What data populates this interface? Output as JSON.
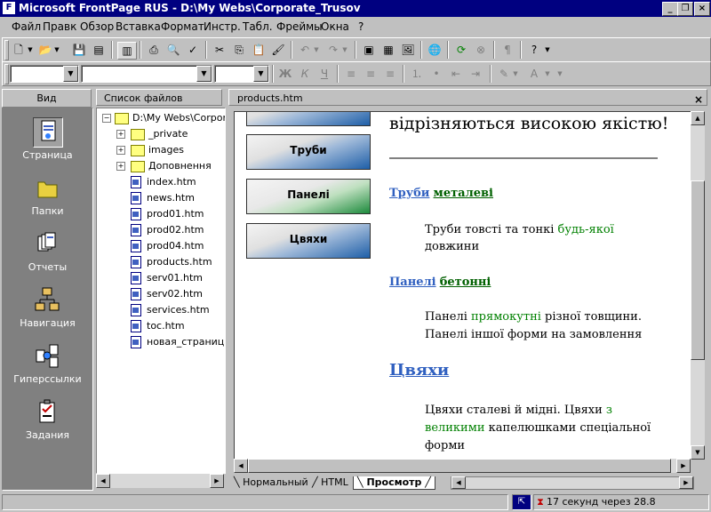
{
  "window": {
    "title": "Microsoft FrontPage RUS - D:\\My Webs\\Corporate_Trusov"
  },
  "menu": [
    "Файл",
    "Правк",
    "Обзор",
    "Вставка",
    "Формат",
    "Инстр.",
    "Табл.",
    "Фреймы",
    "Окна",
    "?"
  ],
  "views": {
    "header": "Вид",
    "items": [
      {
        "label": "Страница",
        "icon": "page-view-icon",
        "selected": true
      },
      {
        "label": "Папки",
        "icon": "folders-view-icon"
      },
      {
        "label": "Отчеты",
        "icon": "reports-view-icon"
      },
      {
        "label": "Навигация",
        "icon": "navigation-view-icon"
      },
      {
        "label": "Гиперссылки",
        "icon": "hyperlinks-view-icon"
      },
      {
        "label": "Задания",
        "icon": "tasks-view-icon"
      }
    ]
  },
  "folder_list": {
    "header": "Список файлов",
    "root": "D:\\My Webs\\Corpora",
    "items": [
      {
        "name": "_private",
        "type": "folder"
      },
      {
        "name": "images",
        "type": "folder"
      },
      {
        "name": "Доповнення",
        "type": "folder"
      },
      {
        "name": "index.htm",
        "type": "page"
      },
      {
        "name": "news.htm",
        "type": "page"
      },
      {
        "name": "prod01.htm",
        "type": "page"
      },
      {
        "name": "prod02.htm",
        "type": "page"
      },
      {
        "name": "prod04.htm",
        "type": "page"
      },
      {
        "name": "products.htm",
        "type": "page"
      },
      {
        "name": "serv01.htm",
        "type": "page"
      },
      {
        "name": "serv02.htm",
        "type": "page"
      },
      {
        "name": "services.htm",
        "type": "page"
      },
      {
        "name": "toc.htm",
        "type": "page"
      },
      {
        "name": "новая_страница",
        "type": "page"
      }
    ]
  },
  "document": {
    "tab_title": "products.htm",
    "close": "×",
    "nav_buttons": [
      "Труби",
      "Панелі",
      "Цвяхи"
    ],
    "heading_partial": "відрізняються високою якістю!",
    "sections": [
      {
        "link": "Труби",
        "rest": "металеві",
        "lines": [
          [
            "Труби товсті та тонкі ",
            "будь-якої"
          ],
          [
            "довжини",
            ""
          ]
        ]
      },
      {
        "link": "Панелі",
        "rest": "бетонні",
        "lines": [
          [
            "Панелі ",
            "прямокутні",
            " різної товщини."
          ],
          [
            "Панелі іншої форми на замовлення",
            ""
          ]
        ]
      },
      {
        "link": "Цвяхи",
        "rest": "",
        "lines": [
          [
            "Цвяхи сталеві й мідні. Цвяхи ",
            "з"
          ],
          [
            "великими",
            " капелюшками спеціальної"
          ],
          [
            "форми",
            ""
          ]
        ]
      }
    ],
    "sec1_line1_a": "Труби товсті та тонкі ",
    "sec1_line1_b": "будь-якої",
    "sec1_line2": "довжини",
    "sec2_line1_a": "Панелі ",
    "sec2_line1_b": "прямокутні",
    "sec2_line1_c": " різної товщини.",
    "sec2_line2": "Панелі іншої форми на замовлення",
    "sec3_line1_a": "Цвяхи сталеві й мідні. Цвяхи ",
    "sec3_line1_b": "з",
    "sec3_line2_a": "великими",
    "sec3_line2_b": " капелюшками спеціальної",
    "sec3_line3": "форми"
  },
  "view_tabs": [
    "Нормальный",
    "HTML",
    "Просмотр"
  ],
  "active_view_tab": "Просмотр",
  "status": {
    "download_time": "17 секунд через 28.8"
  },
  "colors": {
    "titlebar": "#000080",
    "link": "#3060c0",
    "accent_green": "#008000"
  }
}
